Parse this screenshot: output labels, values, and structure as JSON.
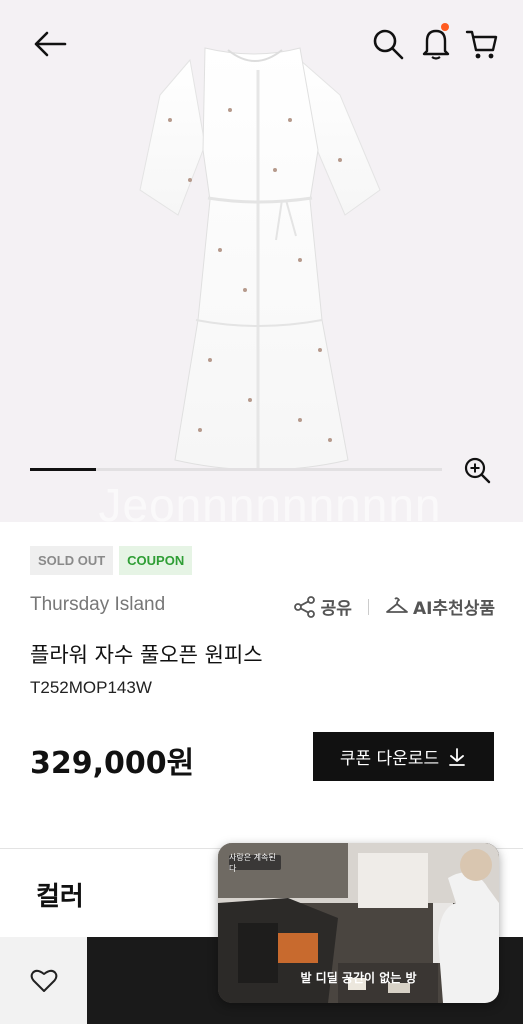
{
  "header": {
    "back_icon": "arrow-left-icon",
    "search_icon": "search-icon",
    "bell_icon": "bell-icon",
    "cart_icon": "cart-icon",
    "notification_dot_color": "#ff5a1f"
  },
  "gallery": {
    "progress": 0.16,
    "zoom_icon": "zoom-in-icon",
    "watermark": "Jeonnnnnnnnnn"
  },
  "product": {
    "badges": [
      "SOLD OUT",
      "COUPON"
    ],
    "brand": "Thursday Island",
    "share_label": "공유",
    "ai_label": "AI추천상품",
    "title": "플라워 자수 풀오픈 원피스",
    "code": "T252MOP143W",
    "price": "329,000원",
    "coupon_button": "쿠폰 다운로드"
  },
  "sections": {
    "color_title": "컬러"
  },
  "bottom_bar": {
    "wish_icon": "heart-icon"
  },
  "video": {
    "tag": "사랑은 계속된다",
    "subtitle": "발 디딜 공간이 없는 방"
  },
  "colors": {
    "accent_dark": "#111111",
    "coupon_green": "#2f9e35",
    "hero_bg": "#f4f1f4"
  }
}
